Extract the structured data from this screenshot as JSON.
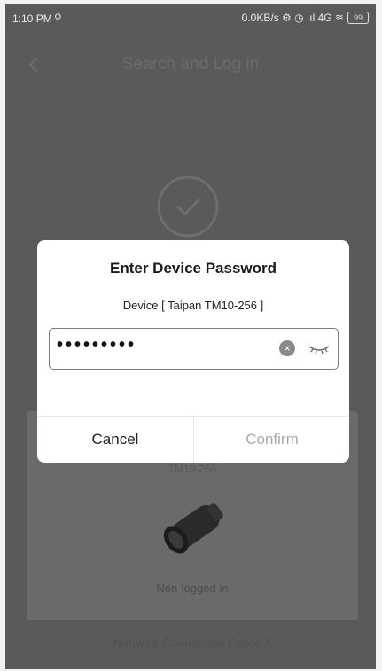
{
  "status_bar": {
    "time": "1:10 PM",
    "small_icon": "⚲",
    "right_text": "0.0KB/s ⚙ ◷ .ıl 4G ≋",
    "battery": "99"
  },
  "header": {
    "back_icon": "chevron-left-icon",
    "title": "Search and Log in"
  },
  "dialog": {
    "title": "Enter Device Password",
    "device_label": "Device [ Taipan TM10-256 ]",
    "password_value": "•••••••••",
    "clear_icon": "×",
    "cancel_label": "Cancel",
    "confirm_label": "Confirm"
  },
  "device_card": {
    "subtitle": "TM10-256",
    "status": "Non-logged in"
  },
  "bottom_link": "Network Connection Failed?",
  "colors": {
    "overlay_bg": "#5a5a5a",
    "dialog_bg": "#ffffff",
    "confirm_disabled": "#aaaaaa"
  }
}
